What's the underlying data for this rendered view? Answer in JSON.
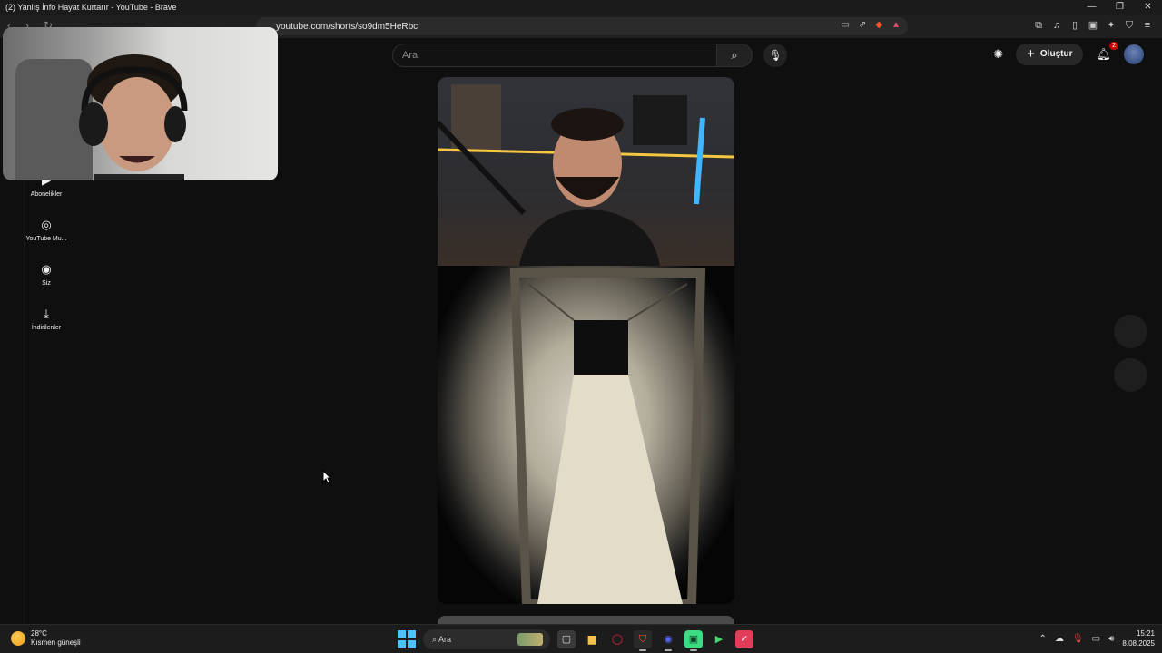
{
  "window": {
    "title": "(2) Yanlış İnfo Hayat Kurtarır - YouTube - Brave",
    "controls": [
      "—",
      "❐",
      "✕"
    ]
  },
  "browser": {
    "url": "youtube.com/shorts/so9dm5HeRbc"
  },
  "youtube": {
    "search_placeholder": "Ara",
    "create_label": "Oluştur",
    "notification_count": "2",
    "sidebar": [
      {
        "label": "Abonelikler",
        "icon": "subscriptions-icon"
      },
      {
        "label": "YouTube Mu...",
        "icon": "youtube-music-icon"
      },
      {
        "label": "Siz",
        "icon": "profile-icon"
      },
      {
        "label": "İndirilenler",
        "icon": "download-icon"
      }
    ]
  },
  "taskbar": {
    "weather_temp": "28°C",
    "weather_desc": "Kısmen güneşli",
    "search_label": "Ara",
    "time": "15:21",
    "date": "8.08.2025"
  },
  "colors": {
    "background": "#0f0f0f",
    "accent_red": "#cc0000",
    "windows_blue": "#4cc2ff"
  }
}
